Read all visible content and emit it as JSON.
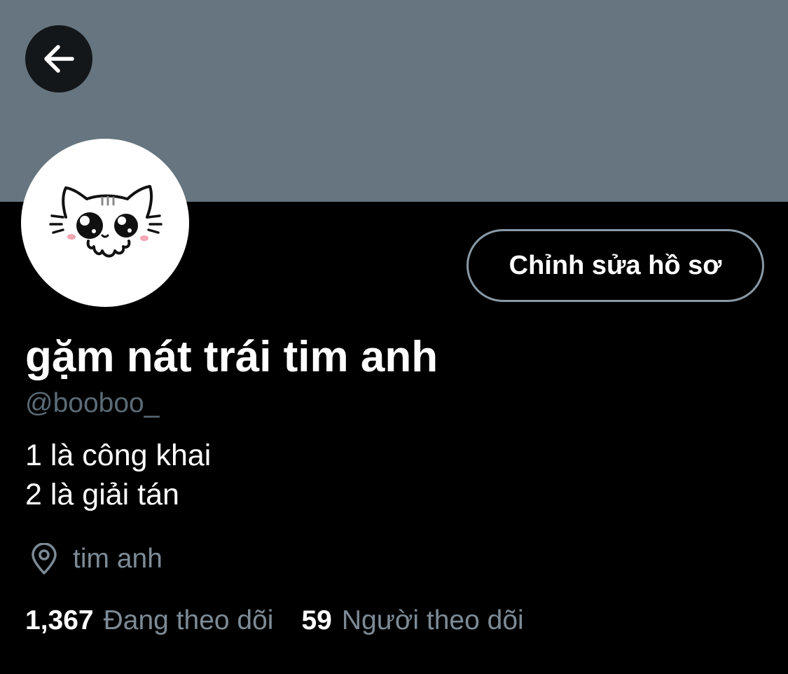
{
  "profile": {
    "display_name": "gặm nát trái tim anh",
    "handle": "@booboo_",
    "bio": [
      "1 là công khai",
      "2 là giải tán"
    ],
    "location": "tim anh",
    "edit_button_label": "Chỉnh sửa hồ sơ",
    "avatar_icon": "cat-face-drawing"
  },
  "stats": {
    "following_count": "1,367",
    "following_label": "Đang theo dõi",
    "followers_count": "59",
    "followers_label": "Người theo dõi"
  },
  "icons": {
    "back": "arrow-left-icon",
    "location": "map-pin-icon"
  },
  "colors": {
    "banner": "#66757f",
    "background": "#000000",
    "back_button_bg": "#14171a",
    "secondary_text": "#7d8b96",
    "button_border": "#8899a6"
  }
}
